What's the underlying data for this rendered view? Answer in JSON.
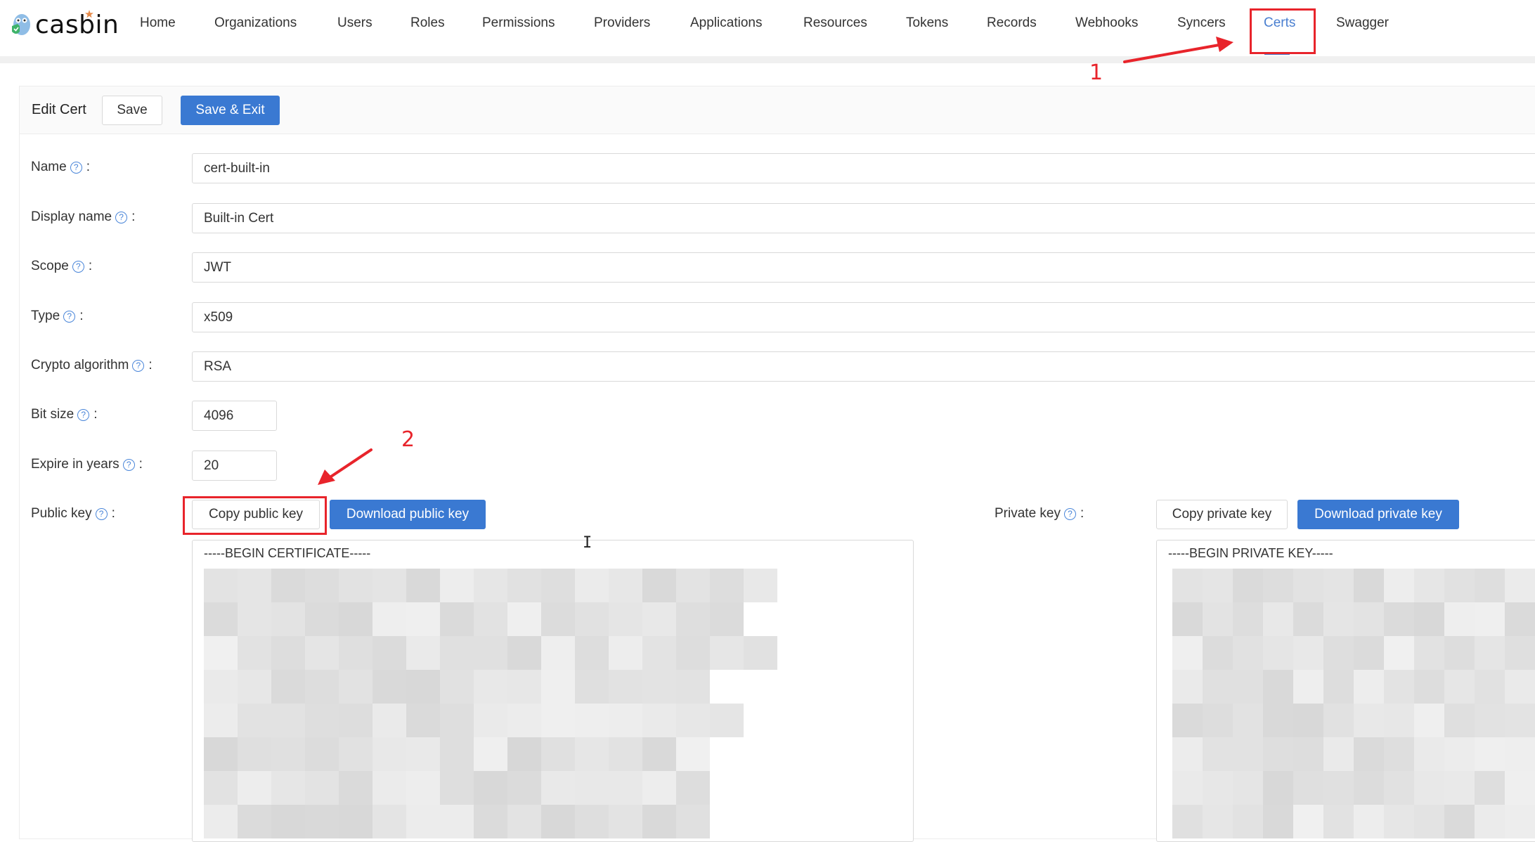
{
  "app": {
    "brand": "casbin"
  },
  "nav": {
    "items": [
      {
        "label": "Home"
      },
      {
        "label": "Organizations"
      },
      {
        "label": "Users"
      },
      {
        "label": "Roles"
      },
      {
        "label": "Permissions"
      },
      {
        "label": "Providers"
      },
      {
        "label": "Applications"
      },
      {
        "label": "Resources"
      },
      {
        "label": "Tokens"
      },
      {
        "label": "Records"
      },
      {
        "label": "Webhooks"
      },
      {
        "label": "Syncers"
      },
      {
        "label": "Certs",
        "active": true
      },
      {
        "label": "Swagger"
      }
    ],
    "active_color": "#4a7fd0"
  },
  "header": {
    "title": "Edit Cert",
    "save_label": "Save",
    "save_exit_label": "Save & Exit"
  },
  "form": {
    "help_icon": "question-circle-icon",
    "colon": ":",
    "fields": [
      {
        "label": "Name",
        "value": "cert-built-in"
      },
      {
        "label": "Display name",
        "value": "Built-in Cert"
      },
      {
        "label": "Scope",
        "value": "JWT"
      },
      {
        "label": "Type",
        "value": "x509"
      },
      {
        "label": "Crypto algorithm",
        "value": "RSA"
      },
      {
        "label": "Bit size",
        "value": "4096"
      },
      {
        "label": "Expire in years",
        "value": "20"
      }
    ],
    "public_key": {
      "label": "Public key",
      "copy_label": "Copy public key",
      "download_label": "Download public key",
      "content_header": "-----BEGIN CERTIFICATE-----",
      "content_redacted": true
    },
    "private_key": {
      "label": "Private key",
      "copy_label": "Copy private key",
      "download_label": "Download private key",
      "content_header": "-----BEGIN PRIVATE KEY-----",
      "content_redacted": true
    }
  },
  "annotations": {
    "color": "#e8242b",
    "step1": "1",
    "step2": "2"
  },
  "colors": {
    "primary": "#3a79d2",
    "border": "#d9d9d9",
    "header_bg": "#fafafa"
  }
}
